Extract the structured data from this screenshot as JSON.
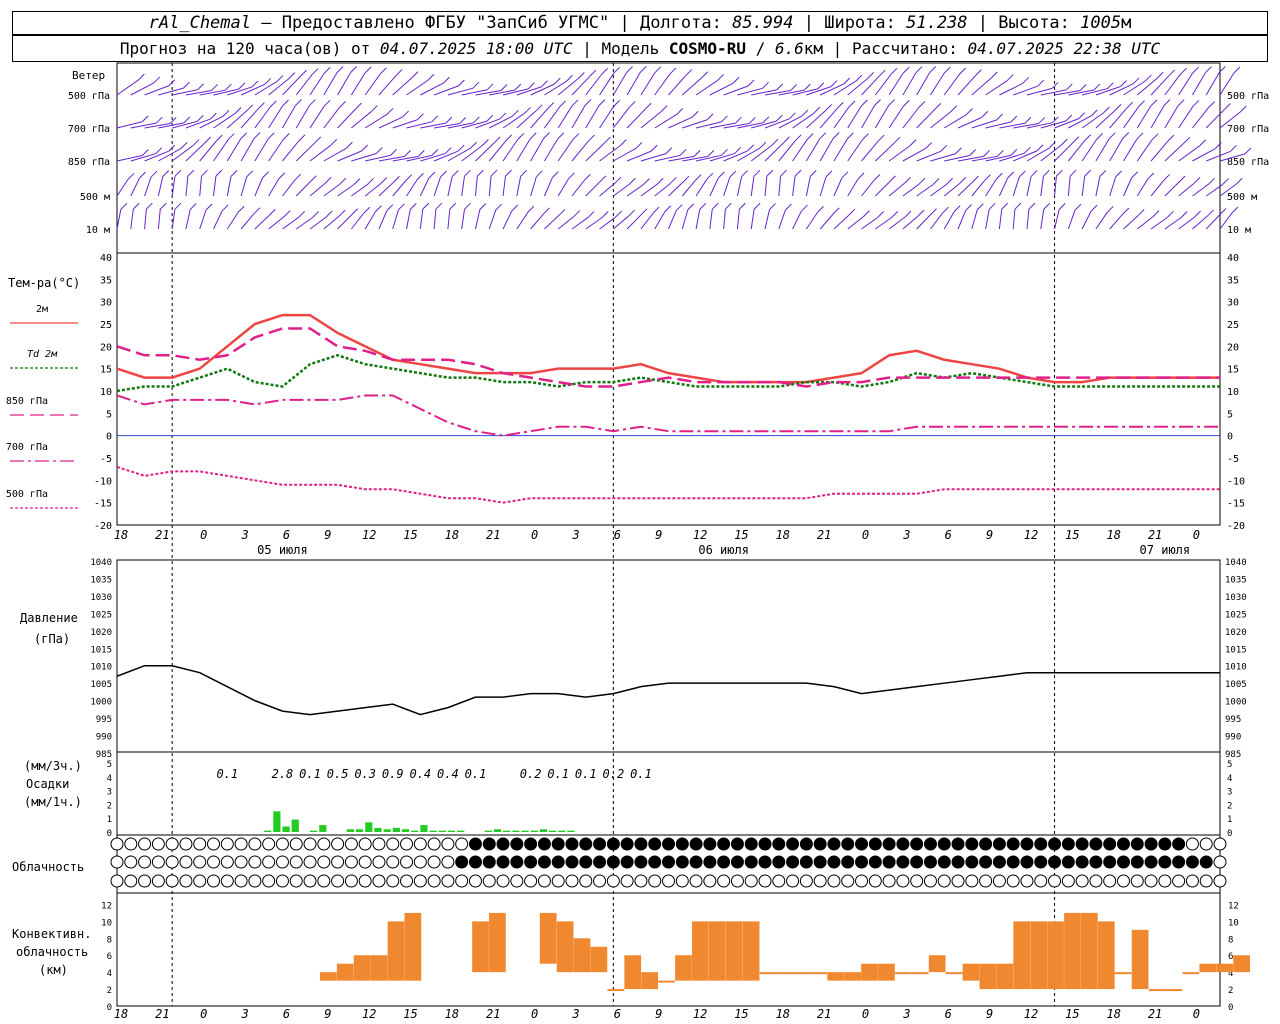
{
  "header": {
    "station": "rAl_Chemal",
    "sep": " — ",
    "provider": "Предоставлено ФГБУ \"ЗапСиб УГМС\"",
    "bar": " | ",
    "lon_label": "Долгота: ",
    "lon": "85.994",
    "lat_label": "Широта: ",
    "lat": "51.238",
    "alt_label": "Высота: ",
    "alt": "1005",
    "alt_unit": "м",
    "forecast_label": "Прогноз на 120 часа(ов) от ",
    "forecast_time": "04.07.2025 18:00 UTC",
    "model_label": " | Модель ",
    "model": "COSMO-RU",
    "model_sep": " / ",
    "resolution": "6.6",
    "res_unit": "км",
    "calc_label": "Рассчитано: ",
    "calc_time": "04.07.2025 22:38 UTC"
  },
  "labels": {
    "wind": "Ветер",
    "wind_levels": [
      "500 гПа",
      "700 гПа",
      "850 гПа",
      "500 м",
      "10  м"
    ],
    "temp": "Тем-ра(°С)",
    "temp_series": [
      "2м",
      "Td  2м",
      "850 гПа",
      "700 гПа",
      "500 гПа"
    ],
    "pressure": [
      "Давление",
      "(гПа)"
    ],
    "precip": [
      "(мм/3ч.)",
      "Осадки",
      "(мм/1ч.)"
    ],
    "cloud": "Облачность",
    "conv": [
      "Конвективн.",
      "облачность",
      "(км)"
    ]
  },
  "colors": {
    "t2m": "#ee4444",
    "td": "#117711",
    "t850": "#e0208a",
    "t700": "#e0208a",
    "t500": "#e0208a",
    "wind": "#6622cc",
    "precip": "#22cc22",
    "conv": "#f08830",
    "pressure": "#000000",
    "zero": "#3344cc"
  },
  "chart_data": [
    {
      "type": "line",
      "title": "Тем-ра(°С)",
      "x_hours_from_start": [
        0,
        3,
        6,
        9,
        12,
        15,
        18,
        21,
        24,
        27,
        30,
        33,
        36,
        39,
        42,
        45,
        48,
        51,
        54,
        57,
        60,
        63,
        66,
        69,
        72,
        75,
        78,
        81,
        84,
        87,
        90,
        93,
        96,
        99,
        102,
        105,
        108,
        111,
        114,
        117,
        120,
        123,
        126,
        129,
        130,
        133,
        136,
        139,
        142,
        145,
        148,
        151,
        154,
        157,
        160
      ],
      "x_ticks": [
        "18",
        "21",
        "0",
        "3",
        "6",
        "9",
        "12",
        "15",
        "18",
        "21",
        "0",
        "3",
        "6",
        "9",
        "12",
        "15",
        "18",
        "21",
        "0",
        "3",
        "6",
        "9",
        "12",
        "15",
        "18",
        "21",
        "0"
      ],
      "dates": [
        "05 июля",
        "06 июля",
        "07 июля"
      ],
      "ylim": [
        -20,
        40
      ],
      "yticks": [
        -20,
        -15,
        -10,
        -5,
        0,
        5,
        10,
        15,
        20,
        25,
        30,
        35,
        40
      ],
      "series": [
        {
          "name": "2м",
          "x": [
            0,
            3,
            6,
            9,
            12,
            15,
            18,
            21,
            24,
            27,
            30,
            33,
            36,
            39,
            42,
            45,
            48,
            51,
            54,
            57,
            60,
            63,
            66,
            69,
            72,
            75,
            78,
            81,
            84,
            87,
            90,
            93,
            96,
            99,
            102,
            105,
            108,
            111,
            114,
            117,
            120
          ],
          "values": [
            15,
            13,
            13,
            15,
            20,
            25,
            27,
            27,
            23,
            20,
            17,
            16,
            15,
            14,
            14,
            14,
            15,
            15,
            15,
            16,
            14,
            13,
            12,
            12,
            12,
            12,
            13,
            14,
            18,
            19,
            17,
            16,
            15,
            13,
            12,
            12,
            13,
            13,
            13,
            13,
            13
          ]
        },
        {
          "name": "Td  2м",
          "x": [
            0,
            3,
            6,
            9,
            12,
            15,
            18,
            21,
            24,
            27,
            30,
            33,
            36,
            39,
            42,
            45,
            48,
            51,
            54,
            57,
            60,
            63,
            66,
            69,
            72,
            75,
            78,
            81,
            84,
            87,
            90,
            93,
            96,
            99,
            102,
            105,
            108,
            111,
            114,
            117,
            120
          ],
          "values": [
            10,
            11,
            11,
            13,
            15,
            12,
            11,
            16,
            18,
            16,
            15,
            14,
            13,
            13,
            12,
            12,
            11,
            12,
            12,
            13,
            12,
            11,
            11,
            11,
            11,
            12,
            12,
            11,
            12,
            14,
            13,
            14,
            13,
            12,
            11,
            11,
            11,
            11,
            11,
            11,
            11
          ]
        },
        {
          "name": "850 гПа",
          "x": [
            0,
            3,
            6,
            9,
            12,
            15,
            18,
            21,
            24,
            27,
            30,
            33,
            36,
            39,
            42,
            45,
            48,
            51,
            54,
            57,
            60,
            63,
            66,
            69,
            72,
            75,
            78,
            81,
            84,
            87,
            90,
            93,
            96,
            99,
            102,
            105,
            108,
            111,
            114,
            117,
            120
          ],
          "values": [
            20,
            18,
            18,
            17,
            18,
            22,
            24,
            24,
            20,
            19,
            17,
            17,
            17,
            16,
            14,
            13,
            12,
            11,
            11,
            12,
            13,
            12,
            12,
            12,
            12,
            11,
            12,
            12,
            13,
            13,
            13,
            13,
            13,
            13,
            13,
            13,
            13,
            13,
            13,
            13,
            13
          ]
        },
        {
          "name": "700 гПа",
          "x": [
            0,
            3,
            6,
            9,
            12,
            15,
            18,
            21,
            24,
            27,
            30,
            33,
            36,
            39,
            42,
            45,
            48,
            51,
            54,
            57,
            60,
            63,
            66,
            69,
            72,
            75,
            78,
            81,
            84,
            87,
            90,
            93,
            96,
            99,
            102,
            105,
            108,
            111,
            114,
            117,
            120
          ],
          "values": [
            9,
            7,
            8,
            8,
            8,
            7,
            8,
            8,
            8,
            9,
            9,
            6,
            3,
            1,
            0,
            1,
            2,
            2,
            1,
            2,
            1,
            1,
            1,
            1,
            1,
            1,
            1,
            1,
            1,
            2,
            2,
            2,
            2,
            2,
            2,
            2,
            2,
            2,
            2,
            2,
            2
          ]
        },
        {
          "name": "500 гПа",
          "x": [
            0,
            3,
            6,
            9,
            12,
            15,
            18,
            21,
            24,
            27,
            30,
            33,
            36,
            39,
            42,
            45,
            48,
            51,
            54,
            57,
            60,
            63,
            66,
            69,
            72,
            75,
            78,
            81,
            84,
            87,
            90,
            93,
            96,
            99,
            102,
            105,
            108,
            111,
            114,
            117,
            120
          ],
          "values": [
            -7,
            -9,
            -8,
            -8,
            -9,
            -10,
            -11,
            -11,
            -11,
            -12,
            -12,
            -13,
            -14,
            -14,
            -15,
            -14,
            -14,
            -14,
            -14,
            -14,
            -14,
            -14,
            -14,
            -14,
            -14,
            -14,
            -13,
            -13,
            -13,
            -13,
            -12,
            -12,
            -12,
            -12,
            -12,
            -12,
            -12,
            -12,
            -12,
            -12,
            -12
          ]
        }
      ]
    },
    {
      "type": "line",
      "title": "Давление",
      "ylim": [
        985,
        1040
      ],
      "yticks": [
        985,
        990,
        995,
        1000,
        1005,
        1010,
        1015,
        1020,
        1025,
        1030,
        1035,
        1040
      ],
      "series": [
        {
          "name": "Давление",
          "x": [
            0,
            3,
            6,
            9,
            12,
            15,
            18,
            21,
            24,
            27,
            30,
            33,
            36,
            39,
            42,
            45,
            48,
            51,
            54,
            57,
            60,
            63,
            66,
            69,
            72,
            75,
            78,
            81,
            84,
            87,
            90,
            93,
            96,
            99,
            102,
            105,
            108,
            111,
            114,
            117,
            120
          ],
          "values": [
            1007,
            1010,
            1010,
            1008,
            1004,
            1000,
            997,
            996,
            997,
            998,
            999,
            996,
            998,
            1001,
            1001,
            1002,
            1002,
            1001,
            1002,
            1004,
            1005,
            1005,
            1005,
            1005,
            1005,
            1005,
            1004,
            1002,
            1003,
            1004,
            1005,
            1006,
            1007,
            1008,
            1008,
            1008,
            1008,
            1008,
            1008,
            1008,
            1008
          ]
        }
      ]
    },
    {
      "type": "bar",
      "title": "Осадки",
      "ylim": [
        0,
        5
      ],
      "yticks": [
        0,
        1,
        2,
        3,
        4,
        5
      ],
      "totals": [
        "0.1",
        "2.8",
        "0.1",
        "0.5",
        "0.3",
        "0.9",
        "0.4",
        "0.4",
        "0.1",
        "0.2",
        "0.1",
        "0.1",
        "0.2",
        "0.1"
      ],
      "total_x": [
        12,
        18,
        21,
        24,
        27,
        30,
        33,
        36,
        39,
        45,
        48,
        51,
        54,
        57
      ],
      "x": [
        16,
        17,
        18,
        19,
        20,
        21,
        22,
        23,
        24,
        25,
        26,
        27,
        28,
        29,
        30,
        31,
        32,
        33,
        34,
        35,
        36,
        37,
        38,
        39,
        40,
        41,
        42,
        43,
        44,
        45,
        46,
        47,
        48,
        49
      ],
      "values": [
        0.1,
        1.5,
        0.4,
        0.9,
        0,
        0.1,
        0.5,
        0,
        0,
        0.2,
        0.2,
        0.7,
        0.3,
        0.2,
        0.3,
        0.2,
        0.1,
        0.5,
        0.1,
        0.1,
        0.1,
        0.1,
        0,
        0,
        0.1,
        0.2,
        0.1,
        0.1,
        0.1,
        0.1,
        0.2,
        0.1,
        0.1,
        0.1
      ]
    },
    {
      "type": "bar",
      "title": "Конвективн. облачность",
      "ylim": [
        0,
        13
      ],
      "yticks": [
        0,
        2,
        4,
        6,
        8,
        10,
        12
      ],
      "segments": [
        [
          12,
          3,
          4
        ],
        [
          13,
          3,
          5
        ],
        [
          14,
          3,
          6
        ],
        [
          15,
          3,
          6
        ],
        [
          16,
          3,
          10
        ],
        [
          17,
          3,
          11
        ],
        [
          21,
          4,
          10
        ],
        [
          22,
          4,
          11
        ],
        [
          25,
          5,
          11
        ],
        [
          26,
          4,
          10
        ],
        [
          27,
          4,
          8
        ],
        [
          28,
          4,
          7
        ],
        [
          29,
          2,
          2
        ],
        [
          30,
          2,
          6
        ],
        [
          31,
          2,
          4
        ],
        [
          32,
          3,
          3
        ],
        [
          33,
          3,
          6
        ],
        [
          34,
          3,
          10
        ],
        [
          35,
          3,
          10
        ],
        [
          36,
          3,
          10
        ],
        [
          37,
          3,
          10
        ],
        [
          38,
          4,
          4
        ],
        [
          39,
          4,
          4
        ],
        [
          40,
          4,
          4
        ],
        [
          41,
          4,
          4
        ],
        [
          42,
          3,
          4
        ],
        [
          43,
          3,
          4
        ],
        [
          44,
          3,
          5
        ],
        [
          45,
          3,
          5
        ],
        [
          46,
          4,
          4
        ],
        [
          47,
          4,
          4
        ],
        [
          48,
          4,
          6
        ],
        [
          49,
          4,
          4
        ],
        [
          50,
          3,
          5
        ],
        [
          51,
          2,
          5
        ],
        [
          52,
          2,
          5
        ],
        [
          53,
          2,
          10
        ],
        [
          54,
          2,
          10
        ],
        [
          55,
          2,
          10
        ],
        [
          56,
          2,
          11
        ],
        [
          57,
          2,
          11
        ],
        [
          58,
          2,
          10
        ],
        [
          59,
          4,
          4
        ],
        [
          60,
          2,
          9
        ],
        [
          61,
          2,
          2
        ],
        [
          62,
          2,
          2
        ],
        [
          63,
          4,
          4
        ],
        [
          64,
          4,
          5
        ],
        [
          65,
          4,
          5
        ],
        [
          66,
          4,
          6
        ]
      ]
    }
  ]
}
